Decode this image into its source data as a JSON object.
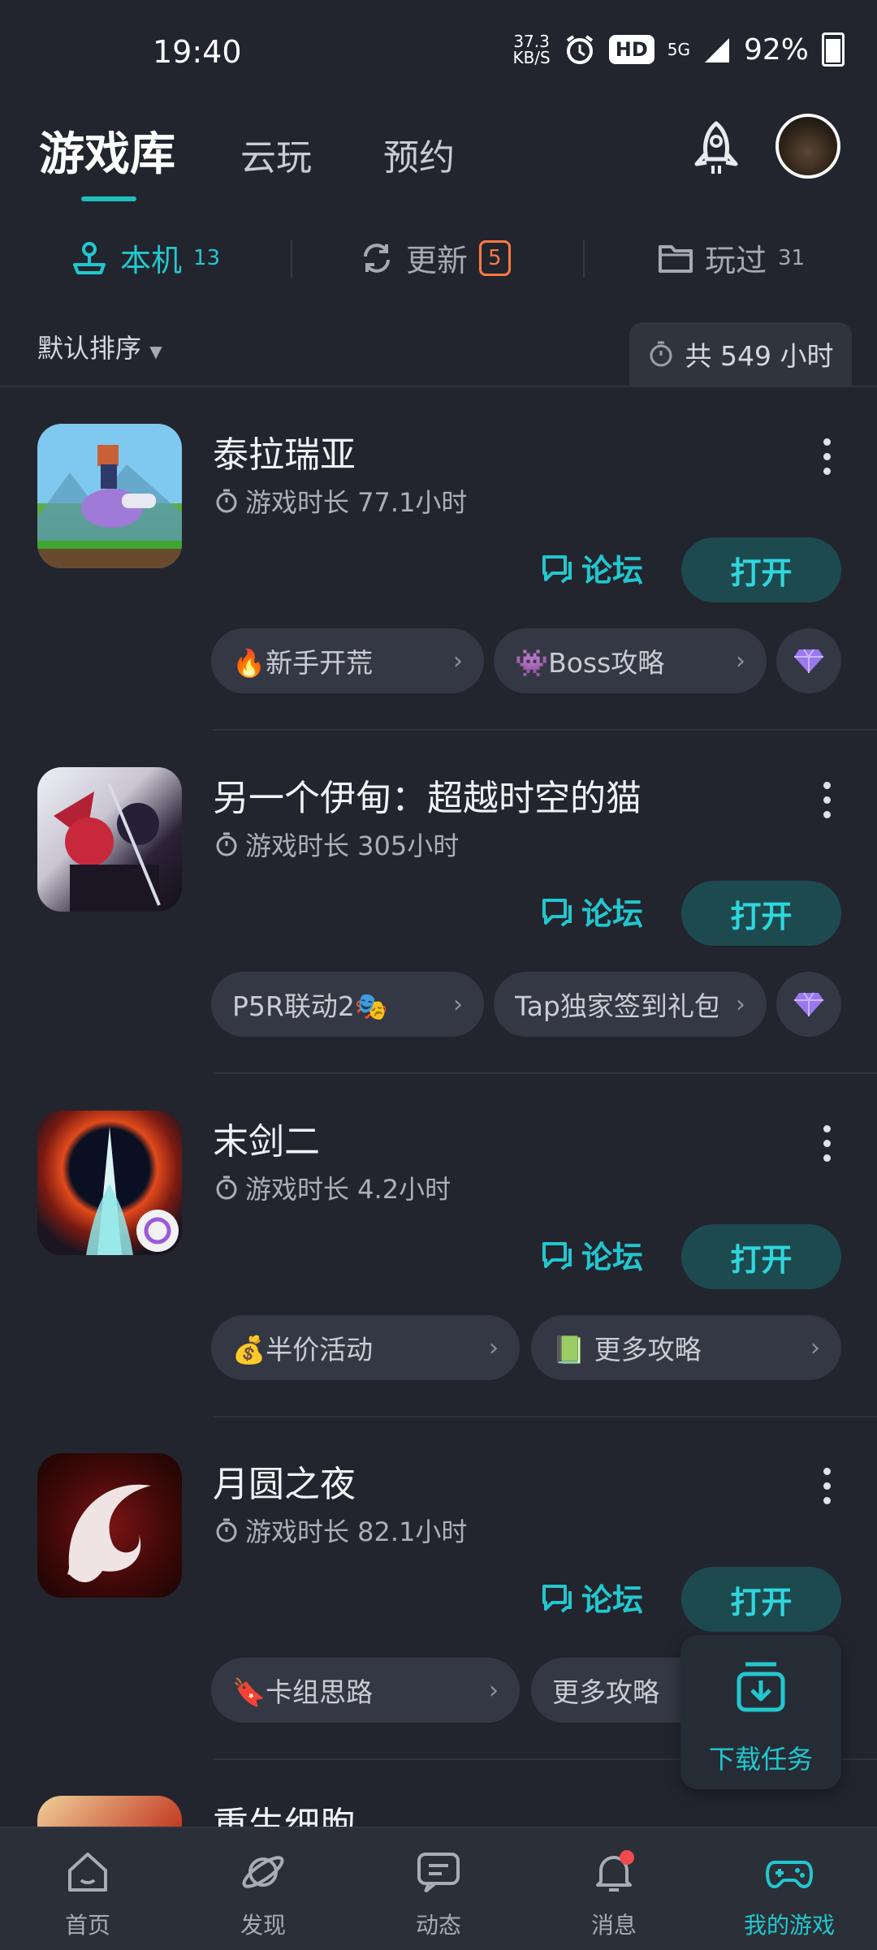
{
  "status_bar": {
    "time": "19:40",
    "net_speed": "37.3",
    "net_unit": "KB/S",
    "hd": "HD",
    "signal": "5G",
    "battery": "92%"
  },
  "header": {
    "tabs": [
      {
        "label": "游戏库",
        "active": true
      },
      {
        "label": "云玩"
      },
      {
        "label": "预约"
      }
    ]
  },
  "subtabs": [
    {
      "label": "本机",
      "count": "13",
      "active": true
    },
    {
      "label": "更新",
      "count": "5"
    },
    {
      "label": "玩过",
      "count": "31"
    }
  ],
  "sort": {
    "label": "默认排序"
  },
  "total_hours": "共 549 小时",
  "games": [
    {
      "name": "泰拉瑞亚",
      "playtime": "游戏时长 77.1小时",
      "forum": "论坛",
      "open": "打开",
      "chips": [
        "🔥新手开荒",
        "👾Boss攻略"
      ],
      "has_gem": true
    },
    {
      "name": "另一个伊甸：超越时空的猫",
      "playtime": "游戏时长 305小时",
      "forum": "论坛",
      "open": "打开",
      "chips": [
        "P5R联动2🎭",
        "Tap独家签到礼包"
      ],
      "has_gem": true
    },
    {
      "name": "末剑二",
      "playtime": "游戏时长 4.2小时",
      "forum": "论坛",
      "open": "打开",
      "chips": [
        "💰半价活动",
        "📗 更多攻略"
      ],
      "has_gem": false
    },
    {
      "name": "月圆之夜",
      "playtime": "游戏时长 82.1小时",
      "forum": "论坛",
      "open": "打开",
      "chips": [
        "🔖卡组思路",
        "更多攻略"
      ],
      "has_gem": false
    },
    {
      "name": "重生细胞"
    }
  ],
  "download_task": "下载任务",
  "bottom_nav": [
    {
      "label": "首页"
    },
    {
      "label": "发现"
    },
    {
      "label": "动态"
    },
    {
      "label": "消息"
    },
    {
      "label": "我的游戏",
      "active": true
    }
  ],
  "colors": {
    "accent": "#22c7cf",
    "background": "#22252e",
    "update_badge": "#ff7a45"
  }
}
